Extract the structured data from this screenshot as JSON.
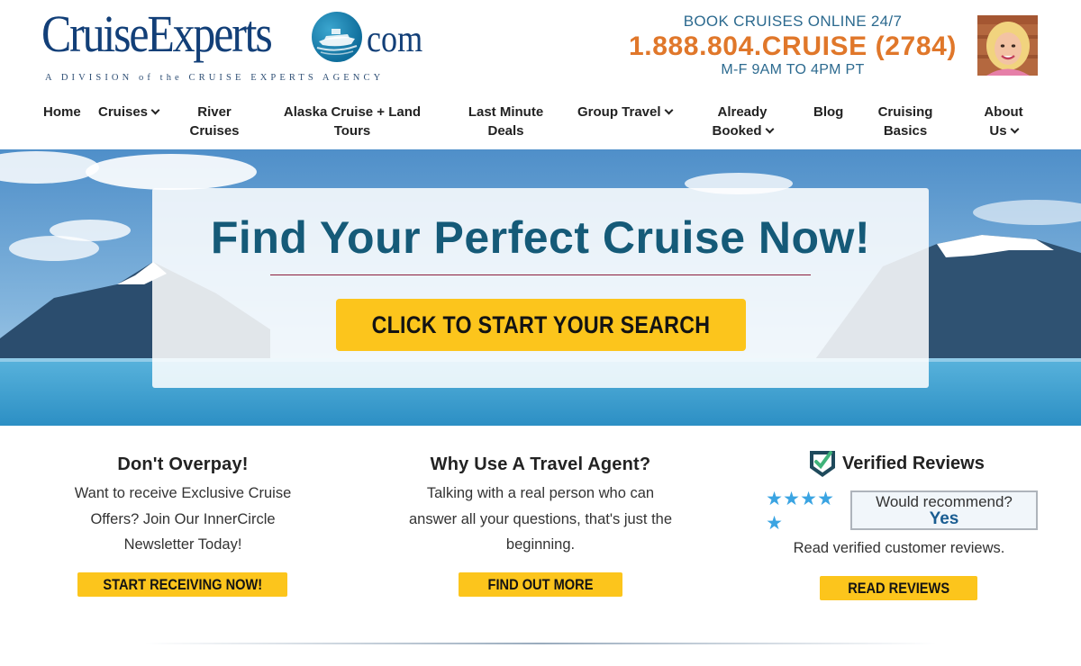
{
  "brand": {
    "logo_main": "CruiseExperts",
    "logo_suffix": "com",
    "tagline": "A DIVISION of the CRUISE EXPERTS AGENCY"
  },
  "contact": {
    "top_line": "BOOK CRUISES ONLINE 24/7",
    "phone": "1.888.804.CRUISE (2784)",
    "hours": "M-F 9AM TO 4PM PT"
  },
  "nav": {
    "items": [
      {
        "line1": "Home",
        "line2": "",
        "dropdown": false
      },
      {
        "line1": "Cruises",
        "line2": "",
        "dropdown": true
      },
      {
        "line1": "River",
        "line2": "Cruises",
        "dropdown": false
      },
      {
        "line1": "Alaska Cruise + Land",
        "line2": "Tours",
        "dropdown": false
      },
      {
        "line1": "Last Minute",
        "line2": "Deals",
        "dropdown": false
      },
      {
        "line1": "Group Travel",
        "line2": "",
        "dropdown": true
      },
      {
        "line1": "Already",
        "line2": "Booked",
        "dropdown": true
      },
      {
        "line1": "Blog",
        "line2": "",
        "dropdown": false
      },
      {
        "line1": "Cruising",
        "line2": "Basics",
        "dropdown": false
      },
      {
        "line1": "About",
        "line2": "Us",
        "dropdown": true
      }
    ]
  },
  "hero": {
    "title": "Find Your Perfect Cruise Now!",
    "button": "CLICK TO START YOUR SEARCH"
  },
  "columns": {
    "overpay": {
      "title": "Don't Overpay!",
      "line1": "Want to receive Exclusive Cruise",
      "line2": "Offers? Join Our InnerCircle",
      "line3": "Newsletter Today!",
      "button": "START RECEIVING NOW!"
    },
    "agent": {
      "title": "Why Use A Travel Agent?",
      "line1": "Talking with a real person who can",
      "line2": "answer all your questions, that's just the",
      "line3": "beginning.",
      "button": "FIND OUT MORE"
    },
    "reviews": {
      "title": "Verified Reviews",
      "rating": 5,
      "recommend_question": "Would recommend?",
      "recommend_answer": "Yes",
      "caption": "Read verified customer reviews.",
      "button": "READ REVIEWS"
    }
  },
  "colors": {
    "brand_navy": "#123f78",
    "phone_orange": "#e0772a",
    "contact_blue": "#2c6a8f",
    "hero_title": "#155a78",
    "button_yellow": "#fcc51c",
    "star_blue": "#3aa4e2"
  },
  "icons": {
    "globe": "ship-globe-icon",
    "verified": "verified-check-icon",
    "chevron": "chevron-down-icon",
    "star": "star-icon"
  }
}
